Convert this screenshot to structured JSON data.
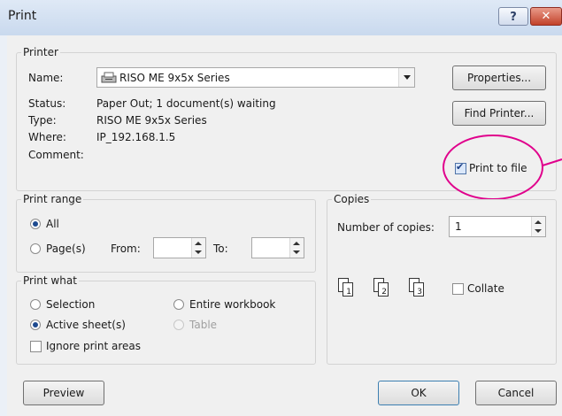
{
  "window": {
    "title": "Print",
    "help_glyph": "?",
    "close_glyph": "✕"
  },
  "printer": {
    "legend": "Printer",
    "name_label": "Name:",
    "name_value": "RISO ME 9x5x Series",
    "status_label": "Status:",
    "status_value": "Paper Out; 1 document(s) waiting",
    "type_label": "Type:",
    "type_value": "RISO ME 9x5x Series",
    "where_label": "Where:",
    "where_value": "IP_192.168.1.5",
    "comment_label": "Comment:",
    "properties_button": "Properties...",
    "find_printer_button": "Find Printer...",
    "print_to_file_label": "Print to file",
    "print_to_file_checked": true
  },
  "print_range": {
    "legend": "Print range",
    "all_label": "All",
    "pages_label": "Page(s)",
    "from_label": "From:",
    "to_label": "To:",
    "from_value": "",
    "to_value": "",
    "selected": "All"
  },
  "copies": {
    "legend": "Copies",
    "number_label": "Number of copies:",
    "number_value": "1",
    "collate_label": "Collate",
    "collate_checked": false,
    "stack_a": [
      "1",
      "2",
      "3"
    ]
  },
  "print_what": {
    "legend": "Print what",
    "selection_label": "Selection",
    "entire_workbook_label": "Entire workbook",
    "active_sheets_label": "Active sheet(s)",
    "table_label": "Table",
    "ignore_print_areas_label": "Ignore print areas",
    "selected": "Active sheet(s)"
  },
  "footer": {
    "preview_button": "Preview",
    "ok_button": "OK",
    "cancel_button": "Cancel"
  },
  "colors": {
    "highlight_ring": "#e0008c",
    "title_bar": "#c9d9ee",
    "close_button": "#c2422a"
  }
}
